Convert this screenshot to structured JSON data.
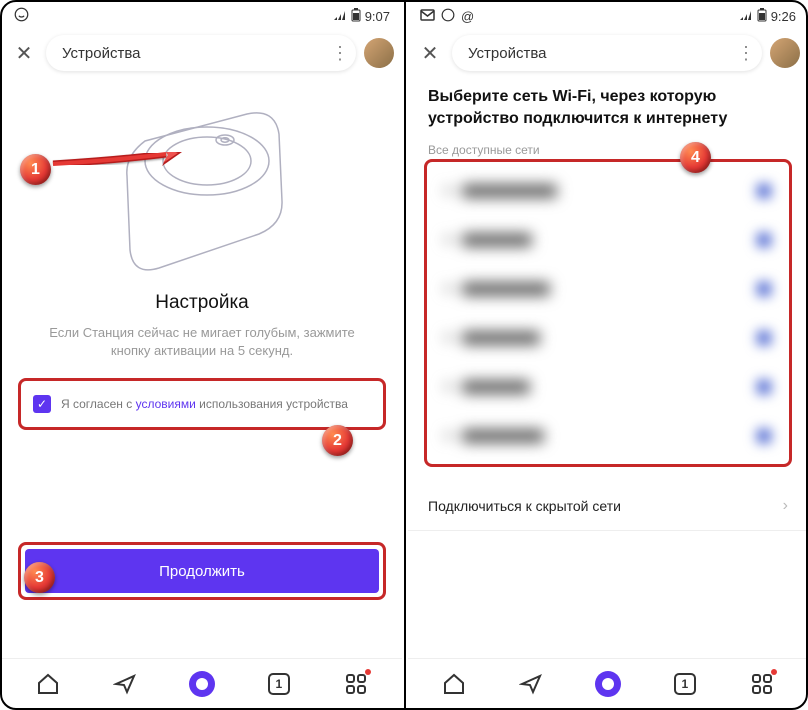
{
  "left": {
    "status": {
      "time": "9:07"
    },
    "header": {
      "title": "Устройства"
    },
    "setup": {
      "title": "Настройка",
      "instruction": "Если Станция сейчас не мигает голубым, зажмите кнопку активации на 5 секунд."
    },
    "consent": {
      "prefix": "Я согласен с ",
      "link": "условиями",
      "suffix": " использования устройства"
    },
    "continue_label": "Продолжить"
  },
  "right": {
    "status": {
      "time": "9:26"
    },
    "header": {
      "title": "Устройства"
    },
    "wifi": {
      "title": "Выберите сеть Wi-Fi, через которую устройство подключится к интернету",
      "subtitle": "Все доступные сети",
      "hidden_label": "Подключиться к скрытой сети"
    }
  },
  "markers": {
    "m1": "1",
    "m2": "2",
    "m3": "3",
    "m4": "4"
  },
  "nav": {
    "one": "1"
  }
}
